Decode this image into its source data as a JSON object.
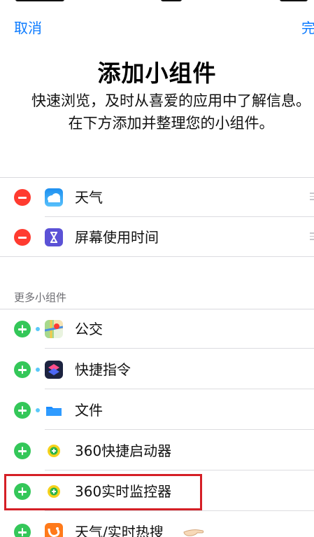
{
  "nav": {
    "cancel_label": "取消",
    "done_label": "完"
  },
  "header": {
    "title": "添加小组件",
    "subtitle": "快速浏览，及时从喜爱的应用中了解信息。在下方添加并整理您的小组件。"
  },
  "active_widgets": [
    {
      "label": "天气",
      "icon": "weather-icon",
      "action": "remove"
    },
    {
      "label": "屏幕使用时间",
      "icon": "screen-time-icon",
      "action": "remove"
    }
  ],
  "more_section": {
    "header": "更多小组件",
    "items": [
      {
        "label": "公交",
        "icon": "maps-icon",
        "action": "add",
        "dot": true
      },
      {
        "label": "快捷指令",
        "icon": "shortcuts-icon",
        "action": "add",
        "dot": true
      },
      {
        "label": "文件",
        "icon": "files-icon",
        "action": "add",
        "dot": true
      },
      {
        "label": "360快捷启动器",
        "icon": "360-icon",
        "action": "add",
        "dot": false
      },
      {
        "label": "360实时监控器",
        "icon": "360-icon",
        "action": "add",
        "dot": false,
        "highlighted": true
      },
      {
        "label": "天气/实时热搜",
        "icon": "uc-browser-icon",
        "action": "add",
        "dot": false
      }
    ]
  },
  "colors": {
    "accent": "#0a7aff",
    "remove": "#ff3b30",
    "add": "#34c759",
    "highlight_border": "#d51f26"
  }
}
